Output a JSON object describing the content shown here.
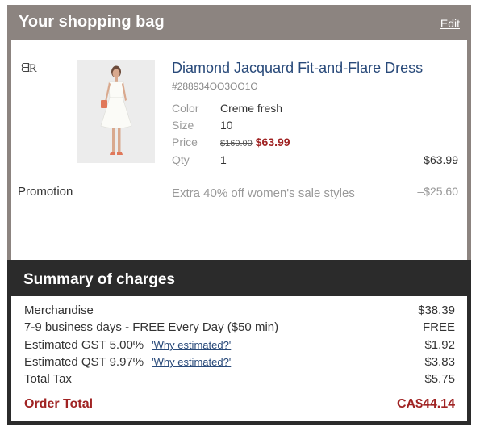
{
  "bag": {
    "title": "Your shopping bag",
    "edit_label": "Edit",
    "brand_mark": "BR"
  },
  "item": {
    "name": "Diamond Jacquard Fit-and-Flare Dress",
    "sku": "#288934OO3OO1O",
    "attributes": {
      "color_label": "Color",
      "color_value": "Creme fresh",
      "size_label": "Size",
      "size_value": "10",
      "price_label": "Price",
      "price_original": "$160.00",
      "price_sale": "$63.99",
      "qty_label": "Qty",
      "qty_value": "1"
    },
    "line_total": "$63.99"
  },
  "promotion": {
    "label": "Promotion",
    "description": "Extra 40% off women's sale styles",
    "amount": "–$25.60"
  },
  "summary": {
    "title": "Summary of charges",
    "rows": [
      {
        "label": "Merchandise",
        "value": "$38.39"
      },
      {
        "label": "7-9 business days - FREE Every Day ($50 min)",
        "value": "FREE"
      },
      {
        "label": "Estimated GST 5.00%",
        "link": "'Why estimated?'",
        "value": "$1.92"
      },
      {
        "label": "Estimated QST 9.97%",
        "link": "'Why estimated?'",
        "value": "$3.83"
      },
      {
        "label": "Total Tax",
        "value": "$5.75"
      }
    ],
    "total_label": "Order Total",
    "total_value": "CA$44.14"
  },
  "colors": {
    "header_bg": "#8c8480",
    "summary_bg": "#2b2b2b",
    "link": "#294a7a",
    "sale": "#a02323"
  }
}
